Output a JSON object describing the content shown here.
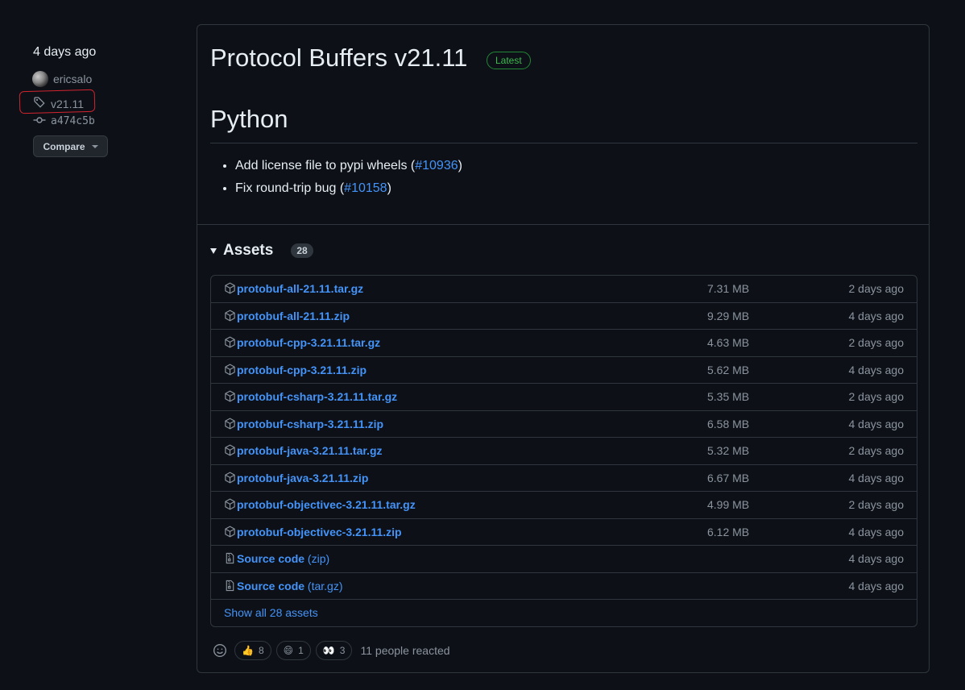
{
  "meta": {
    "date": "4 days ago",
    "author": "ericsalo",
    "tag": "v21.11",
    "commit": "a474c5b",
    "compare_label": "Compare"
  },
  "release": {
    "title": "Protocol Buffers v21.11",
    "badge": "Latest",
    "section_heading": "Python",
    "notes": [
      {
        "text_before": "Add license file to pypi wheels (",
        "link": "#10936",
        "text_after": ")"
      },
      {
        "text_before": "Fix round-trip bug (",
        "link": "#10158",
        "text_after": ")"
      }
    ]
  },
  "assets": {
    "title": "Assets",
    "count": "28",
    "show_all": "Show all 28 assets",
    "items": [
      {
        "name": "protobuf-all-21.11.tar.gz",
        "size": "7.31 MB",
        "date": "2 days ago",
        "icon": "package-icon"
      },
      {
        "name": "protobuf-all-21.11.zip",
        "size": "9.29 MB",
        "date": "4 days ago",
        "icon": "package-icon"
      },
      {
        "name": "protobuf-cpp-3.21.11.tar.gz",
        "size": "4.63 MB",
        "date": "2 days ago",
        "icon": "package-icon"
      },
      {
        "name": "protobuf-cpp-3.21.11.zip",
        "size": "5.62 MB",
        "date": "4 days ago",
        "icon": "package-icon"
      },
      {
        "name": "protobuf-csharp-3.21.11.tar.gz",
        "size": "5.35 MB",
        "date": "2 days ago",
        "icon": "package-icon"
      },
      {
        "name": "protobuf-csharp-3.21.11.zip",
        "size": "6.58 MB",
        "date": "4 days ago",
        "icon": "package-icon"
      },
      {
        "name": "protobuf-java-3.21.11.tar.gz",
        "size": "5.32 MB",
        "date": "2 days ago",
        "icon": "package-icon"
      },
      {
        "name": "protobuf-java-3.21.11.zip",
        "size": "6.67 MB",
        "date": "4 days ago",
        "icon": "package-icon"
      },
      {
        "name": "protobuf-objectivec-3.21.11.tar.gz",
        "size": "4.99 MB",
        "date": "2 days ago",
        "icon": "package-icon"
      },
      {
        "name": "protobuf-objectivec-3.21.11.zip",
        "size": "6.12 MB",
        "date": "4 days ago",
        "icon": "package-icon"
      },
      {
        "name": "Source code",
        "suffix": "(zip)",
        "size": "",
        "date": "4 days ago",
        "icon": "file-zip-icon"
      },
      {
        "name": "Source code",
        "suffix": "(tar.gz)",
        "size": "",
        "date": "4 days ago",
        "icon": "file-zip-icon"
      }
    ]
  },
  "reactions": {
    "items": [
      {
        "emoji": "👍",
        "count": "8",
        "icon": "thumbs-up-icon"
      },
      {
        "emoji": "😄",
        "count": "1",
        "icon": "laugh-icon"
      },
      {
        "emoji": "👀",
        "count": "3",
        "icon": "eyes-icon"
      }
    ],
    "summary": "11 people reacted"
  },
  "colors": {
    "background": "#0d1117",
    "link": "#4493f8",
    "latest_badge": "#3fb950",
    "annotation": "#d1242f"
  }
}
